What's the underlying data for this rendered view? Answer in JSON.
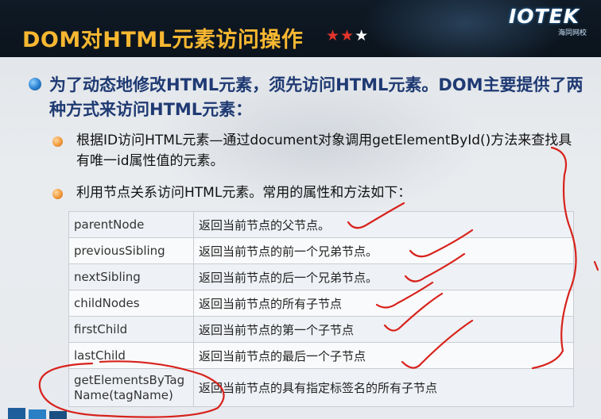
{
  "header": {
    "title": "DOM对HTML元素访问操作",
    "stars_on": "★★",
    "stars_off": "★",
    "logo_text": "IOTEK",
    "logo_sub": "海同网校"
  },
  "main": {
    "bullet1": "为了动态地修改HTML元素，须先访问HTML元素。DOM主要提供了两种方式来访问HTML元素：",
    "sub_bullets": [
      "根据ID访问HTML元素—通过document对象调用getElementById()方法来查找具有唯一id属性值的元素。",
      "利用节点关系访问HTML元素。常用的属性和方法如下："
    ]
  },
  "table": {
    "rows": [
      {
        "name": "parentNode",
        "desc": "返回当前节点的父节点。"
      },
      {
        "name": "previousSibling",
        "desc": "返回当前节点的前一个兄弟节点。"
      },
      {
        "name": "nextSibling",
        "desc": "返回当前节点的后一个兄弟节点。"
      },
      {
        "name": "childNodes",
        "desc": "返回当前节点的所有子节点"
      },
      {
        "name": "firstChild",
        "desc": "返回当前节点的第一个子节点"
      },
      {
        "name": "lastChild",
        "desc": "返回当前节点的最后一个子节点"
      },
      {
        "name": "getElementsByTagName(tagName)",
        "desc": "返回当前节点的具有指定标签名的所有子节点"
      }
    ]
  },
  "colors": {
    "title": "#f7b731",
    "star_on": "#e3332b",
    "bullet_text": "#1f3a73",
    "annotation": "#d8221c"
  }
}
